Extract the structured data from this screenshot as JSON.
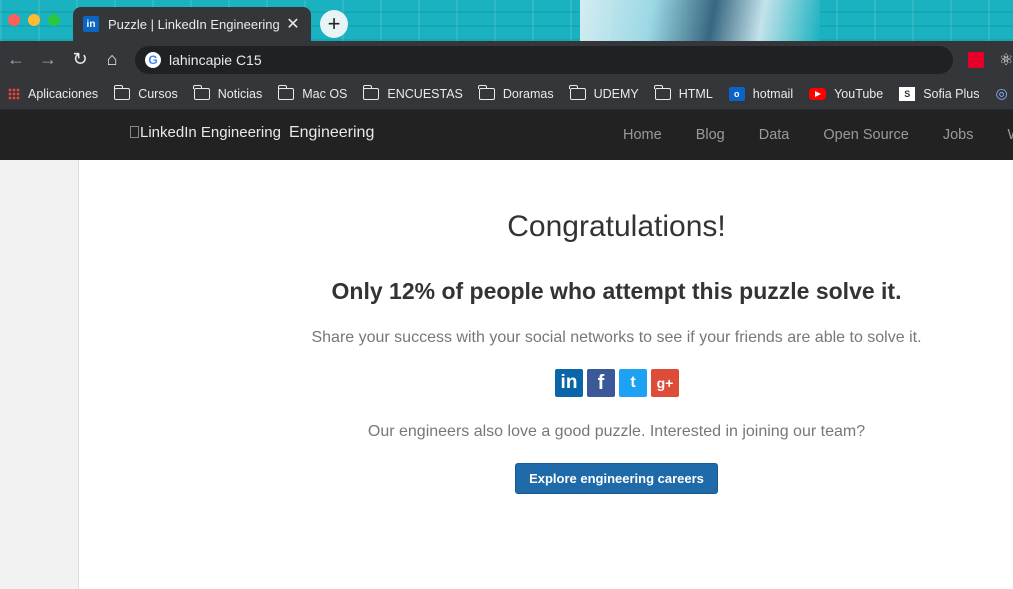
{
  "browser": {
    "tab": {
      "title": "Puzzle | LinkedIn Engineering",
      "favicon": "in",
      "close": "✕"
    },
    "new_tab": "+",
    "omnibox": {
      "text": "lahincapie C15",
      "engine_icon": "G"
    },
    "nav_icons": {
      "back": "←",
      "forward": "→",
      "reload": "↻",
      "home": "⌂"
    },
    "bookmarks": [
      {
        "label": "Aplicaciones",
        "icon": "apps-grid"
      },
      {
        "label": "Cursos",
        "icon": "folder"
      },
      {
        "label": "Noticias",
        "icon": "folder"
      },
      {
        "label": "Mac OS",
        "icon": "folder"
      },
      {
        "label": "ENCUESTAS",
        "icon": "folder"
      },
      {
        "label": "Doramas",
        "icon": "folder"
      },
      {
        "label": "UDEMY",
        "icon": "folder"
      },
      {
        "label": "HTML",
        "icon": "folder"
      },
      {
        "label": "hotmail",
        "icon": "outlook"
      },
      {
        "label": "YouTube",
        "icon": "youtube"
      },
      {
        "label": "Sofia Plus",
        "icon": "sofia"
      }
    ]
  },
  "site": {
    "logo_alt": "LinkedIn Engineering",
    "logo_word": "Engineering",
    "nav": [
      "Home",
      "Blog",
      "Data",
      "Open Source",
      "Jobs",
      "W"
    ]
  },
  "main": {
    "heading": "Congratulations!",
    "subheading": "Only 12% of people who attempt this puzzle solve it.",
    "share_text": "Share your success with your social networks to see if your friends are able to solve it.",
    "social": {
      "linkedin": "in",
      "facebook": "f",
      "twitter": "t",
      "googleplus": "g+"
    },
    "engineers_text": "Our engineers also love a good puzzle. Interested in joining our team?",
    "cta_label": "Explore engineering careers"
  }
}
